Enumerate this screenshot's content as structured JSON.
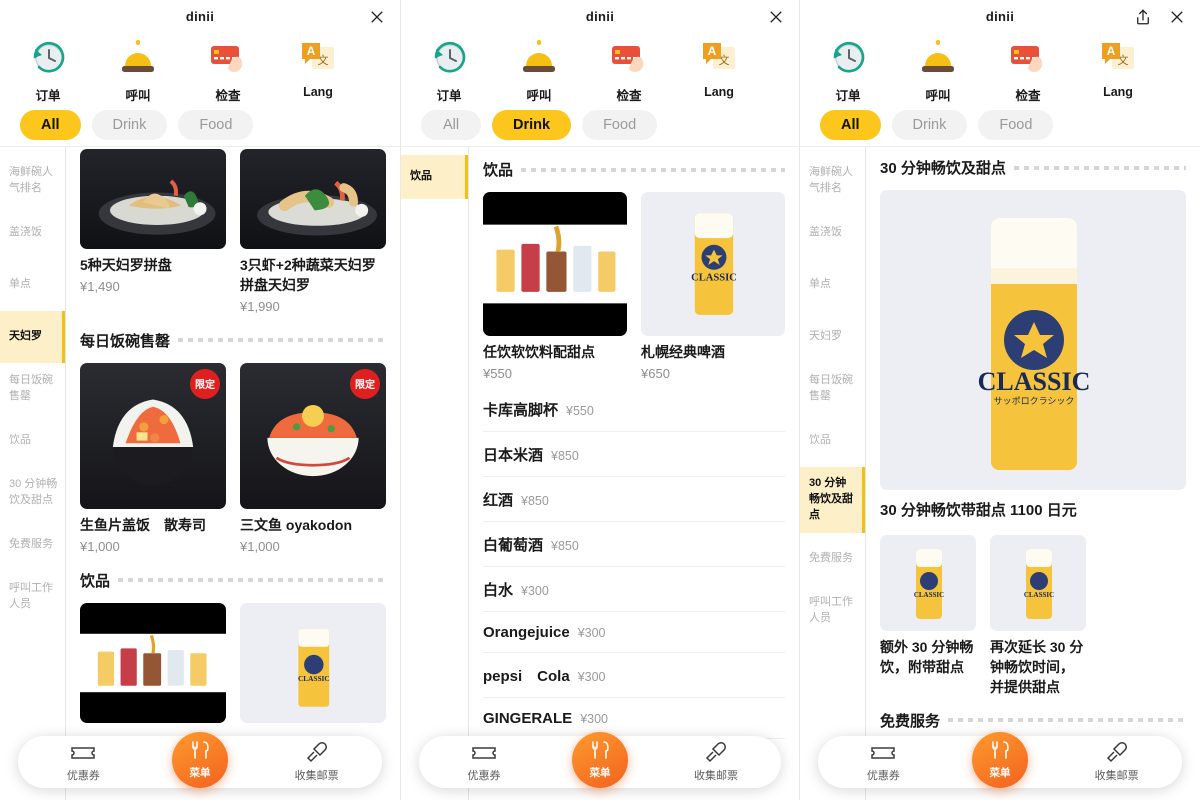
{
  "app": {
    "title": "dinii"
  },
  "icons": {
    "order": "订单",
    "call": "呼叫",
    "check": "检查",
    "lang": "Lang"
  },
  "filters": {
    "all": "All",
    "drink": "Drink",
    "food": "Food"
  },
  "categories": [
    "海鲜碗人气排名",
    "盖浇饭",
    "单点",
    "天妇罗",
    "每日饭碗售罄",
    "饮品",
    "30 分钟畅饮及甜点",
    "免费服务",
    "呼叫工作人员"
  ],
  "panel1": {
    "active_filter": "All",
    "active_category": "天妇罗",
    "tempura_items": [
      {
        "name": "5种天妇罗拼盘",
        "price": "¥1,490"
      },
      {
        "name": "3只虾+2种蔬菜天妇罗拼盘天妇罗",
        "price": "¥1,990"
      }
    ],
    "section_daily": "每日饭碗售罄",
    "daily_items": [
      {
        "name": "生鱼片盖饭　散寿司",
        "price": "¥1,000",
        "badge": "限定"
      },
      {
        "name": "三文鱼 oyakodon",
        "price": "¥1,000",
        "badge": "限定"
      }
    ],
    "section_drinks": "饮品"
  },
  "panel2": {
    "active_filter": "Drink",
    "active_category": "饮品",
    "section_title": "饮品",
    "cards": [
      {
        "name": "任饮软饮料配甜点",
        "price": "¥550"
      },
      {
        "name": "札幌经典啤酒",
        "price": "¥650"
      }
    ],
    "list": [
      {
        "name": "卡库高脚杯",
        "price": "¥550"
      },
      {
        "name": "日本米酒",
        "price": "¥850"
      },
      {
        "name": "红酒",
        "price": "¥850"
      },
      {
        "name": "白葡萄酒",
        "price": "¥850"
      },
      {
        "name": "白水",
        "price": "¥300"
      },
      {
        "name": "Orangejuice",
        "price": "¥300"
      },
      {
        "name": "pepsi　Cola",
        "price": "¥300"
      },
      {
        "name": "GINGERALE",
        "price": "¥300"
      }
    ]
  },
  "panel3": {
    "active_filter": "All",
    "active_category": "30 分钟畅饮及甜点",
    "section_title": "30 分钟畅饮及甜点",
    "hero_name": "30 分钟畅饮带甜点 1100 日元",
    "items": [
      {
        "name": "额外 30 分钟畅饮，附带甜点"
      },
      {
        "name": "再次延长 30 分钟畅饮时间，并提供甜点"
      }
    ],
    "section_free": "免费服务"
  },
  "bottom_nav": {
    "coupon": "优惠券",
    "menu": "菜单",
    "stamp": "收集邮票"
  },
  "colors": {
    "accent_yellow": "#fcc61d",
    "sidebar_active": "#fdf0c8",
    "menu_orange": "#f2621f",
    "badge_red": "#e02020"
  }
}
